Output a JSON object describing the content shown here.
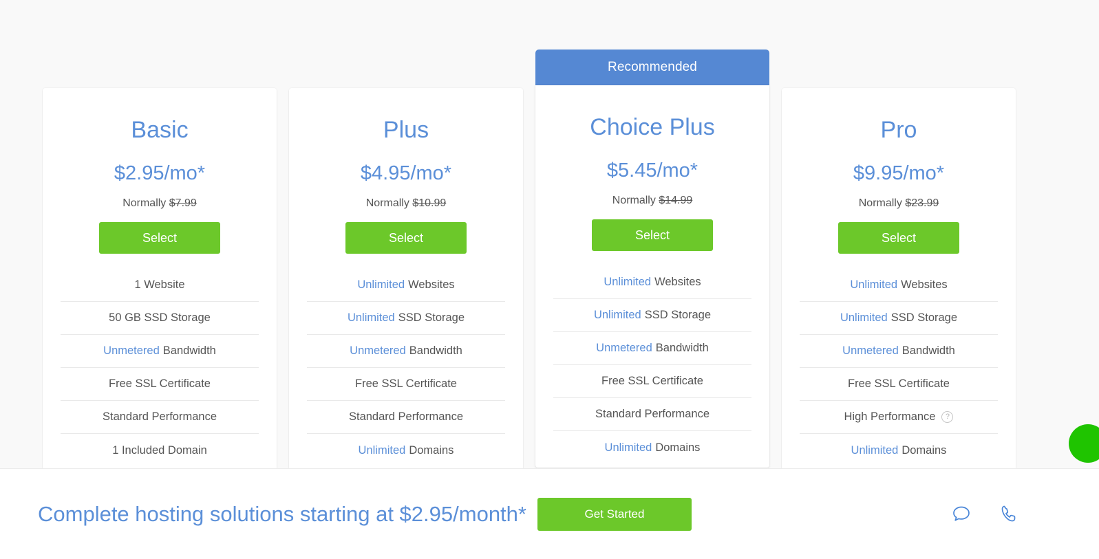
{
  "recommended_badge": "Recommended",
  "plans": [
    {
      "name": "Basic",
      "price": "$2.95/mo*",
      "normally_label": "Normally",
      "normally_price": "$7.99",
      "select_label": "Select",
      "featured": false,
      "features": [
        {
          "highlight": "",
          "text": "1 Website",
          "help": false
        },
        {
          "highlight": "",
          "text": "50 GB SSD Storage",
          "help": false
        },
        {
          "highlight": "Unmetered",
          "text": "Bandwidth",
          "help": false
        },
        {
          "highlight": "",
          "text": "Free SSL Certificate",
          "help": false
        },
        {
          "highlight": "",
          "text": "Standard Performance",
          "help": false
        },
        {
          "highlight": "",
          "text": "1 Included Domain",
          "help": false
        }
      ]
    },
    {
      "name": "Plus",
      "price": "$4.95/mo*",
      "normally_label": "Normally",
      "normally_price": "$10.99",
      "select_label": "Select",
      "featured": false,
      "features": [
        {
          "highlight": "Unlimited",
          "text": "Websites",
          "help": false
        },
        {
          "highlight": "Unlimited",
          "text": "SSD Storage",
          "help": false
        },
        {
          "highlight": "Unmetered",
          "text": "Bandwidth",
          "help": false
        },
        {
          "highlight": "",
          "text": "Free SSL Certificate",
          "help": false
        },
        {
          "highlight": "",
          "text": "Standard Performance",
          "help": false
        },
        {
          "highlight": "Unlimited",
          "text": "Domains",
          "help": false
        }
      ]
    },
    {
      "name": "Choice Plus",
      "price": "$5.45/mo*",
      "normally_label": "Normally",
      "normally_price": "$14.99",
      "select_label": "Select",
      "featured": true,
      "features": [
        {
          "highlight": "Unlimited",
          "text": "Websites",
          "help": false
        },
        {
          "highlight": "Unlimited",
          "text": "SSD Storage",
          "help": false
        },
        {
          "highlight": "Unmetered",
          "text": "Bandwidth",
          "help": false
        },
        {
          "highlight": "",
          "text": "Free SSL Certificate",
          "help": false
        },
        {
          "highlight": "",
          "text": "Standard Performance",
          "help": false
        },
        {
          "highlight": "Unlimited",
          "text": "Domains",
          "help": false
        }
      ]
    },
    {
      "name": "Pro",
      "price": "$9.95/mo*",
      "normally_label": "Normally",
      "normally_price": "$23.99",
      "select_label": "Select",
      "featured": false,
      "features": [
        {
          "highlight": "Unlimited",
          "text": "Websites",
          "help": false
        },
        {
          "highlight": "Unlimited",
          "text": "SSD Storage",
          "help": false
        },
        {
          "highlight": "Unmetered",
          "text": "Bandwidth",
          "help": false
        },
        {
          "highlight": "",
          "text": "Free SSL Certificate",
          "help": false
        },
        {
          "highlight": "",
          "text": "High Performance",
          "help": true,
          "help_glyph": "?"
        },
        {
          "highlight": "Unlimited",
          "text": "Domains",
          "help": false
        }
      ]
    }
  ],
  "bottom_bar": {
    "headline": "Complete hosting solutions starting at $2.95/month*",
    "cta_label": "Get Started",
    "icons": [
      {
        "name": "chat-icon"
      },
      {
        "name": "phone-icon"
      }
    ]
  },
  "colors": {
    "accent_blue": "#5b8fd8",
    "banner_blue": "#5588d3",
    "cta_green": "#6cc82a",
    "bubble_green": "#1fc400",
    "page_bg": "#f9f9f9",
    "card_bg": "#ffffff",
    "body_text": "#555555",
    "divider": "#e9e9e9"
  }
}
